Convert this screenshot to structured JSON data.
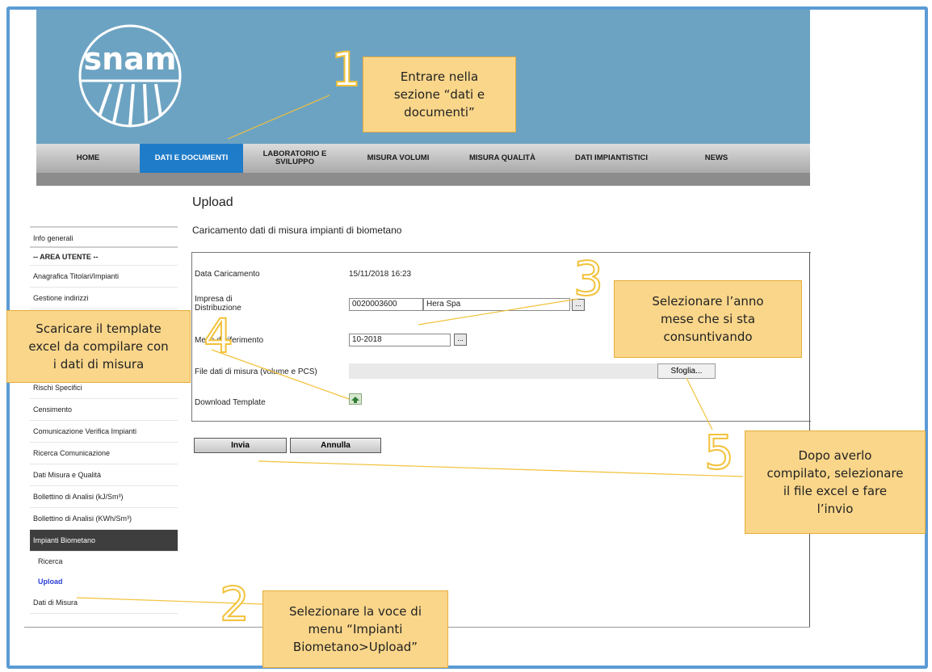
{
  "logo_text": "snam",
  "nav": {
    "items": [
      {
        "label": "HOME",
        "active": false
      },
      {
        "label": "DATI E DOCUMENTI",
        "active": true
      },
      {
        "label": "LABORATORIO E\nSVILUPPO",
        "active": false
      },
      {
        "label": "MISURA VOLUMI",
        "active": false
      },
      {
        "label": "MISURA QUALITÀ",
        "active": false
      },
      {
        "label": "DATI IMPIANTISTICI",
        "active": false
      },
      {
        "label": "NEWS",
        "active": false
      }
    ]
  },
  "sidebar": {
    "info_generali": "Info generali",
    "area_utente": "-- AREA UTENTE --",
    "anagrafica": "Anagrafica Titolari/Impianti",
    "gestione_indirizzi": "Gestione indirizzi",
    "rischi_specifici": "Rischi Specifici",
    "censimento": "Censimento",
    "comunicazione": "Comunicazione Verifica Impianti",
    "ricerca_comunicazione": "Ricerca Comunicazione",
    "dati_misura_qualita": "Dati Misura e Qualità",
    "bollettino_kj": "Bollettino di Analisi (kJ/Sm³)",
    "bollettino_kwh": "Bollettino di Analisi (KWh/Sm³)",
    "impianti_biometano": "Impianti Biometano",
    "ricerca": "Ricerca",
    "upload": "Upload",
    "dati_di_misura": "Dati di Misura"
  },
  "main": {
    "title": "Upload",
    "subtitle": "Caricamento dati di misura impianti di biometano"
  },
  "form": {
    "data_caricamento_label": "Data Caricamento",
    "data_caricamento_value": "15/11/2018 16:23",
    "impresa_label": "Impresa di\nDistribuzione",
    "impresa_code": "0020003600",
    "impresa_name": "Hera Spa",
    "mese_label": "Mese di riferimento",
    "mese_value": "10-2018",
    "file_label": "File dati di misura (volume e PCS)",
    "browse_label": "Sfoglia...",
    "download_label": "Download Template",
    "lookup_label": "..."
  },
  "actions": {
    "send": "Invia",
    "cancel": "Annulla"
  },
  "callouts": {
    "c1_num": "1",
    "c1_text": "Entrare nella\nsezione “dati e\ndocumenti”",
    "c2_num": "2",
    "c2_text": "Selezionare la voce di\nmenu “Impianti\nBiometano>Upload”",
    "c3_num": "3",
    "c3_text": "Selezionare l’anno\nmese che si sta\nconsuntivando",
    "c4_num": "4",
    "c4_text": "Scaricare il template\nexcel da compilare con\ni dati di misura",
    "c5_num": "5",
    "c5_text": "Dopo averlo\ncompilato, selezionare\nil file excel e fare\nl’invio"
  },
  "colors": {
    "header_bg": "#6da3c2",
    "nav_active": "#1f7cc9",
    "callout_bg": "#fad68a",
    "callout_border": "#e7ad3b",
    "number_stroke": "#f2c23a",
    "frame_border": "#5b9bd5"
  }
}
